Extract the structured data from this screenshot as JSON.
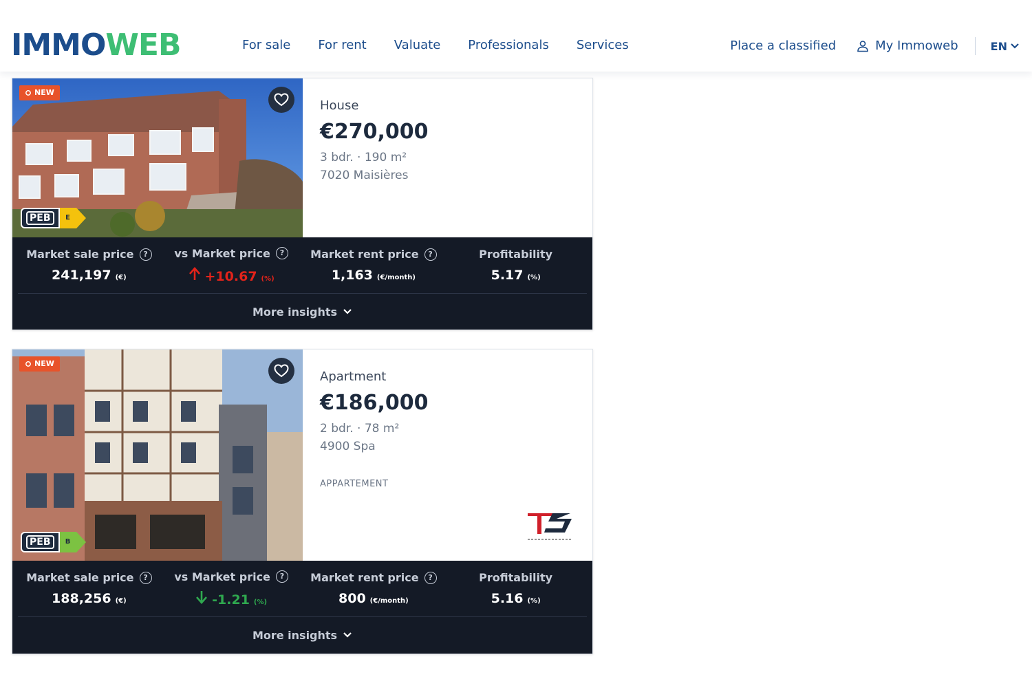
{
  "header": {
    "logo_part1": "IMMO",
    "logo_part2": "WEB",
    "nav": [
      "For sale",
      "For rent",
      "Valuate",
      "Professionals",
      "Services"
    ],
    "place_classified": "Place a classified",
    "my_account": "My Immoweb",
    "language": "EN"
  },
  "listings": [
    {
      "badge": "NEW",
      "type": "House",
      "price": "€270,000",
      "specs": "3 bdr. · 190 m²",
      "location": "7020 Maisières",
      "peb_label": "PEB",
      "peb_grade": "E",
      "insights": {
        "market_sale_label": "Market sale price",
        "market_sale_value": "241,197",
        "market_sale_unit": "(€)",
        "vs_market_label": "vs Market price",
        "vs_market_value": "+10.67",
        "vs_market_unit": "(%)",
        "market_rent_label": "Market rent price",
        "market_rent_value": "1,163",
        "market_rent_unit": "(€/month)",
        "profitability_label": "Profitability",
        "profitability_value": "5.17",
        "profitability_unit": "(%)",
        "more": "More insights"
      }
    },
    {
      "badge": "NEW",
      "type": "Apartment",
      "price": "€186,000",
      "specs": "2 bdr. · 78 m²",
      "location": "4900 Spa",
      "description": "APPARTEMENT",
      "peb_label": "PEB",
      "peb_grade": "B",
      "insights": {
        "market_sale_label": "Market sale price",
        "market_sale_value": "188,256",
        "market_sale_unit": "(€)",
        "vs_market_label": "vs Market price",
        "vs_market_value": "-1.21",
        "vs_market_unit": "(%)",
        "market_rent_label": "Market rent price",
        "market_rent_value": "800",
        "market_rent_unit": "(€/month)",
        "profitability_label": "Profitability",
        "profitability_value": "5.16",
        "profitability_unit": "(%)",
        "more": "More insights"
      }
    }
  ],
  "colors": {
    "brand_blue": "#1c4d8c",
    "brand_green": "#3ebe74",
    "new_badge": "#e8532a",
    "negative": "#e2231a",
    "positive": "#2fa84f",
    "insights_bg": "#141a26"
  }
}
